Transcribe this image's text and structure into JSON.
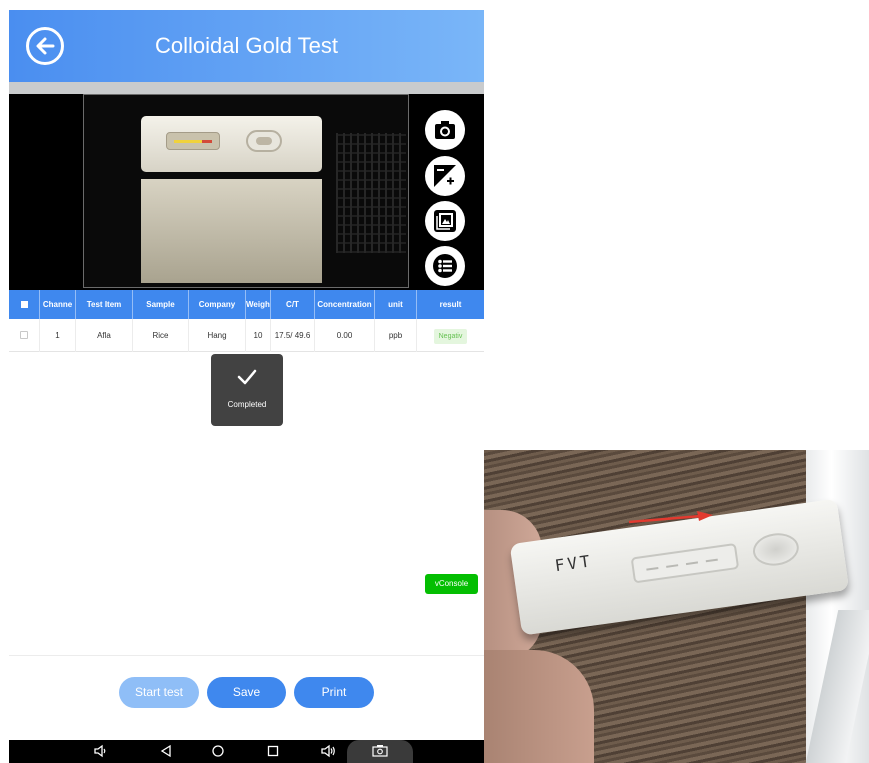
{
  "app": {
    "title": "Colloidal Gold Test"
  },
  "colors": {
    "header_start": "#4a8ef0",
    "header_end": "#7ab6f8",
    "table_header": "#3f88ee",
    "button_primary": "#3f88ee",
    "button_disabled": "#8fbef7",
    "negative_badge_bg": "#e4f6de",
    "negative_badge_text": "#66c152",
    "vconsole": "#04be02"
  },
  "camera": {
    "icons": [
      "camera-icon",
      "exposure-icon",
      "gallery-icon",
      "list-icon"
    ]
  },
  "table": {
    "headers": {
      "channel": "Channe",
      "test_item": "Test Item",
      "sample": "Sample",
      "company": "Company",
      "weight": "Weight",
      "ct": "C/T",
      "concentration": "Concentration",
      "unit": "unit",
      "result": "result"
    },
    "rows": [
      {
        "channel": "1",
        "test_item": "Afla",
        "sample": "Rice",
        "company": "Hang",
        "weight": "10",
        "ct": "17.5/ 49.6",
        "concentration": "0.00",
        "unit": "ppb",
        "result": "Negativ"
      }
    ]
  },
  "toast": {
    "label": "Completed",
    "icon": "check-icon"
  },
  "vconsole": {
    "label": "vConsole"
  },
  "actions": {
    "start_label": "Start test",
    "save_label": "Save",
    "print_label": "Print"
  },
  "navbar": {
    "icons": [
      "volume-down-icon",
      "back-triangle-icon",
      "home-circle-icon",
      "recents-square-icon",
      "volume-up-icon",
      "screenshot-icon"
    ]
  },
  "photo": {
    "strip_label": "FVT"
  }
}
